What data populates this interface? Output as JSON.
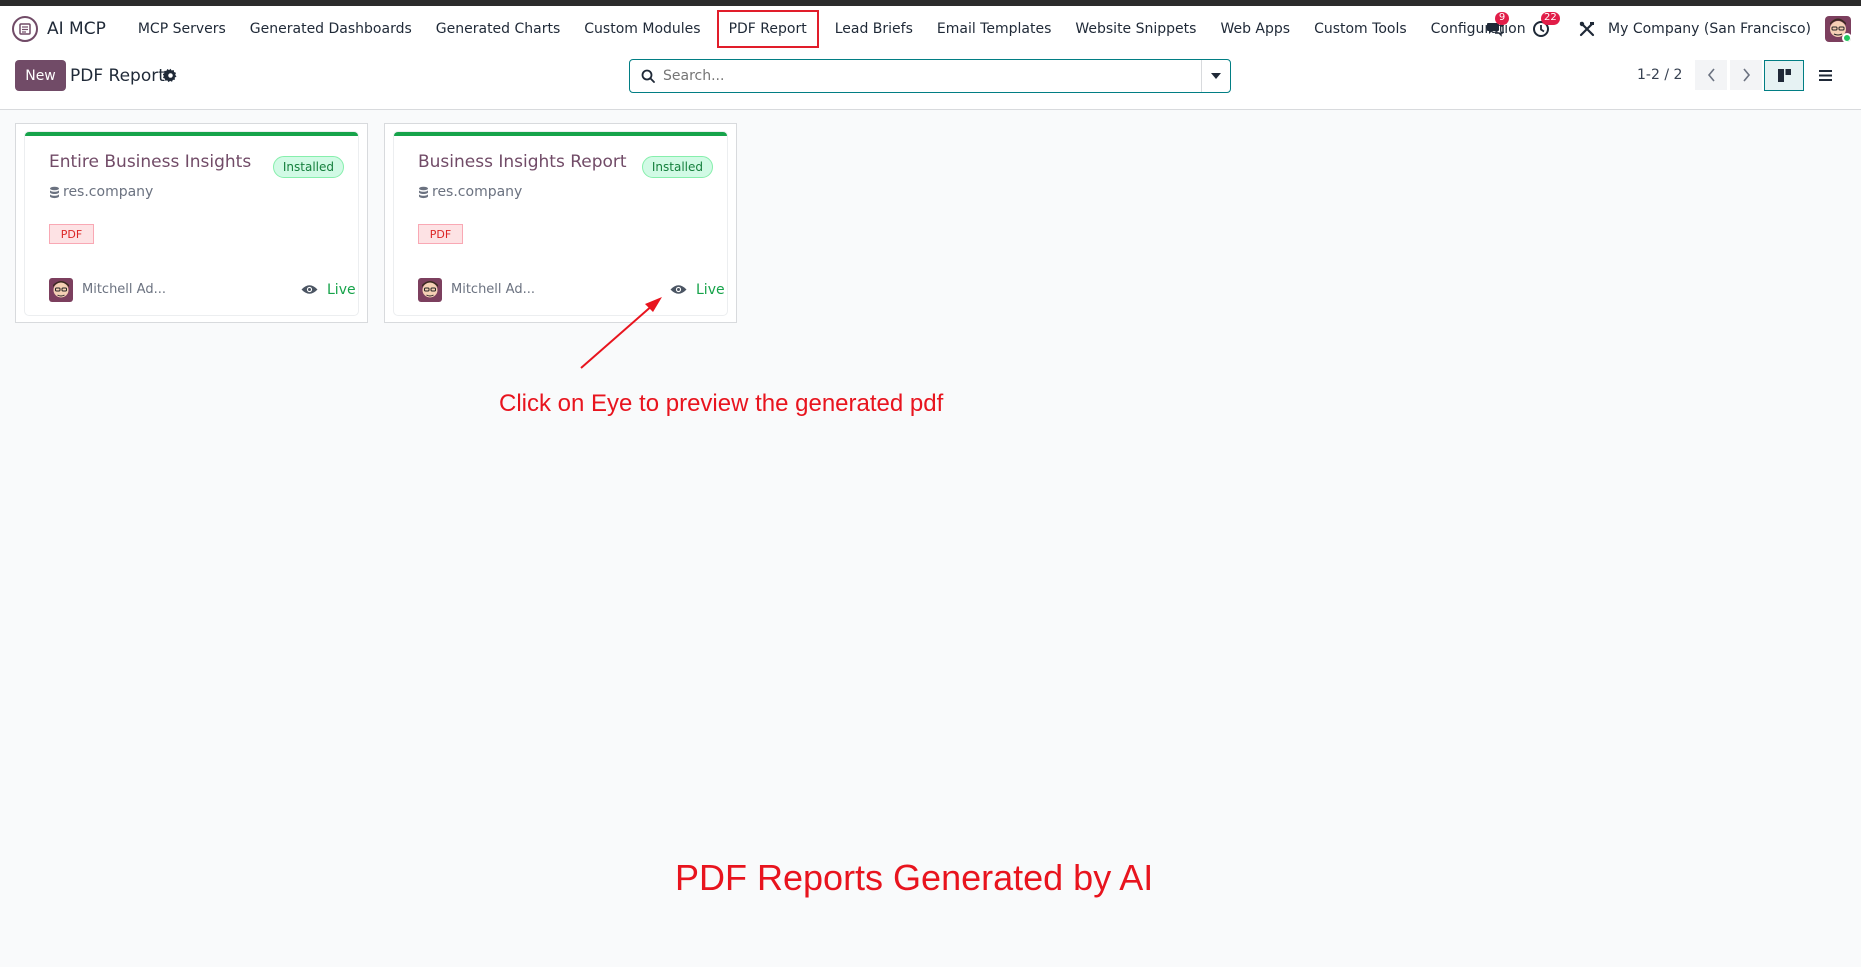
{
  "app": {
    "name": "AI MCP",
    "brand_color": "#714b67",
    "accent_color": "#017e84"
  },
  "menu": [
    {
      "label": "MCP Servers"
    },
    {
      "label": "Generated Dashboards"
    },
    {
      "label": "Generated Charts"
    },
    {
      "label": "Custom Modules"
    },
    {
      "label": "PDF Report",
      "active": true
    },
    {
      "label": "Lead Briefs"
    },
    {
      "label": "Email Templates"
    },
    {
      "label": "Website Snippets"
    },
    {
      "label": "Web Apps"
    },
    {
      "label": "Custom Tools"
    },
    {
      "label": "Configuration"
    }
  ],
  "systray": {
    "messages_icon": "chat-bubbles-icon",
    "messages_count": "9",
    "activities_icon": "clock-icon",
    "activities_count": "22",
    "tools_icon": "crossed-tools-icon",
    "company": "My Company (San Francisco)"
  },
  "control": {
    "new_label": "New",
    "title": "PDF Report",
    "search_placeholder": "Search...",
    "pager": "1-2 / 2",
    "views": [
      "kanban",
      "list"
    ],
    "active_view": "kanban"
  },
  "records": [
    {
      "title": "Entire Business Insights",
      "status": "Installed",
      "model": "res.company",
      "tag": "PDF",
      "author": "Mitchell Ad...",
      "state": "Live"
    },
    {
      "title": "Business Insights Report",
      "status": "Installed",
      "model": "res.company",
      "tag": "PDF",
      "author": "Mitchell Ad...",
      "state": "Live"
    }
  ],
  "annotations": {
    "hint": "Click on Eye to preview the generated pdf",
    "caption": "PDF Reports Generated by AI",
    "color": "#e8141e"
  }
}
